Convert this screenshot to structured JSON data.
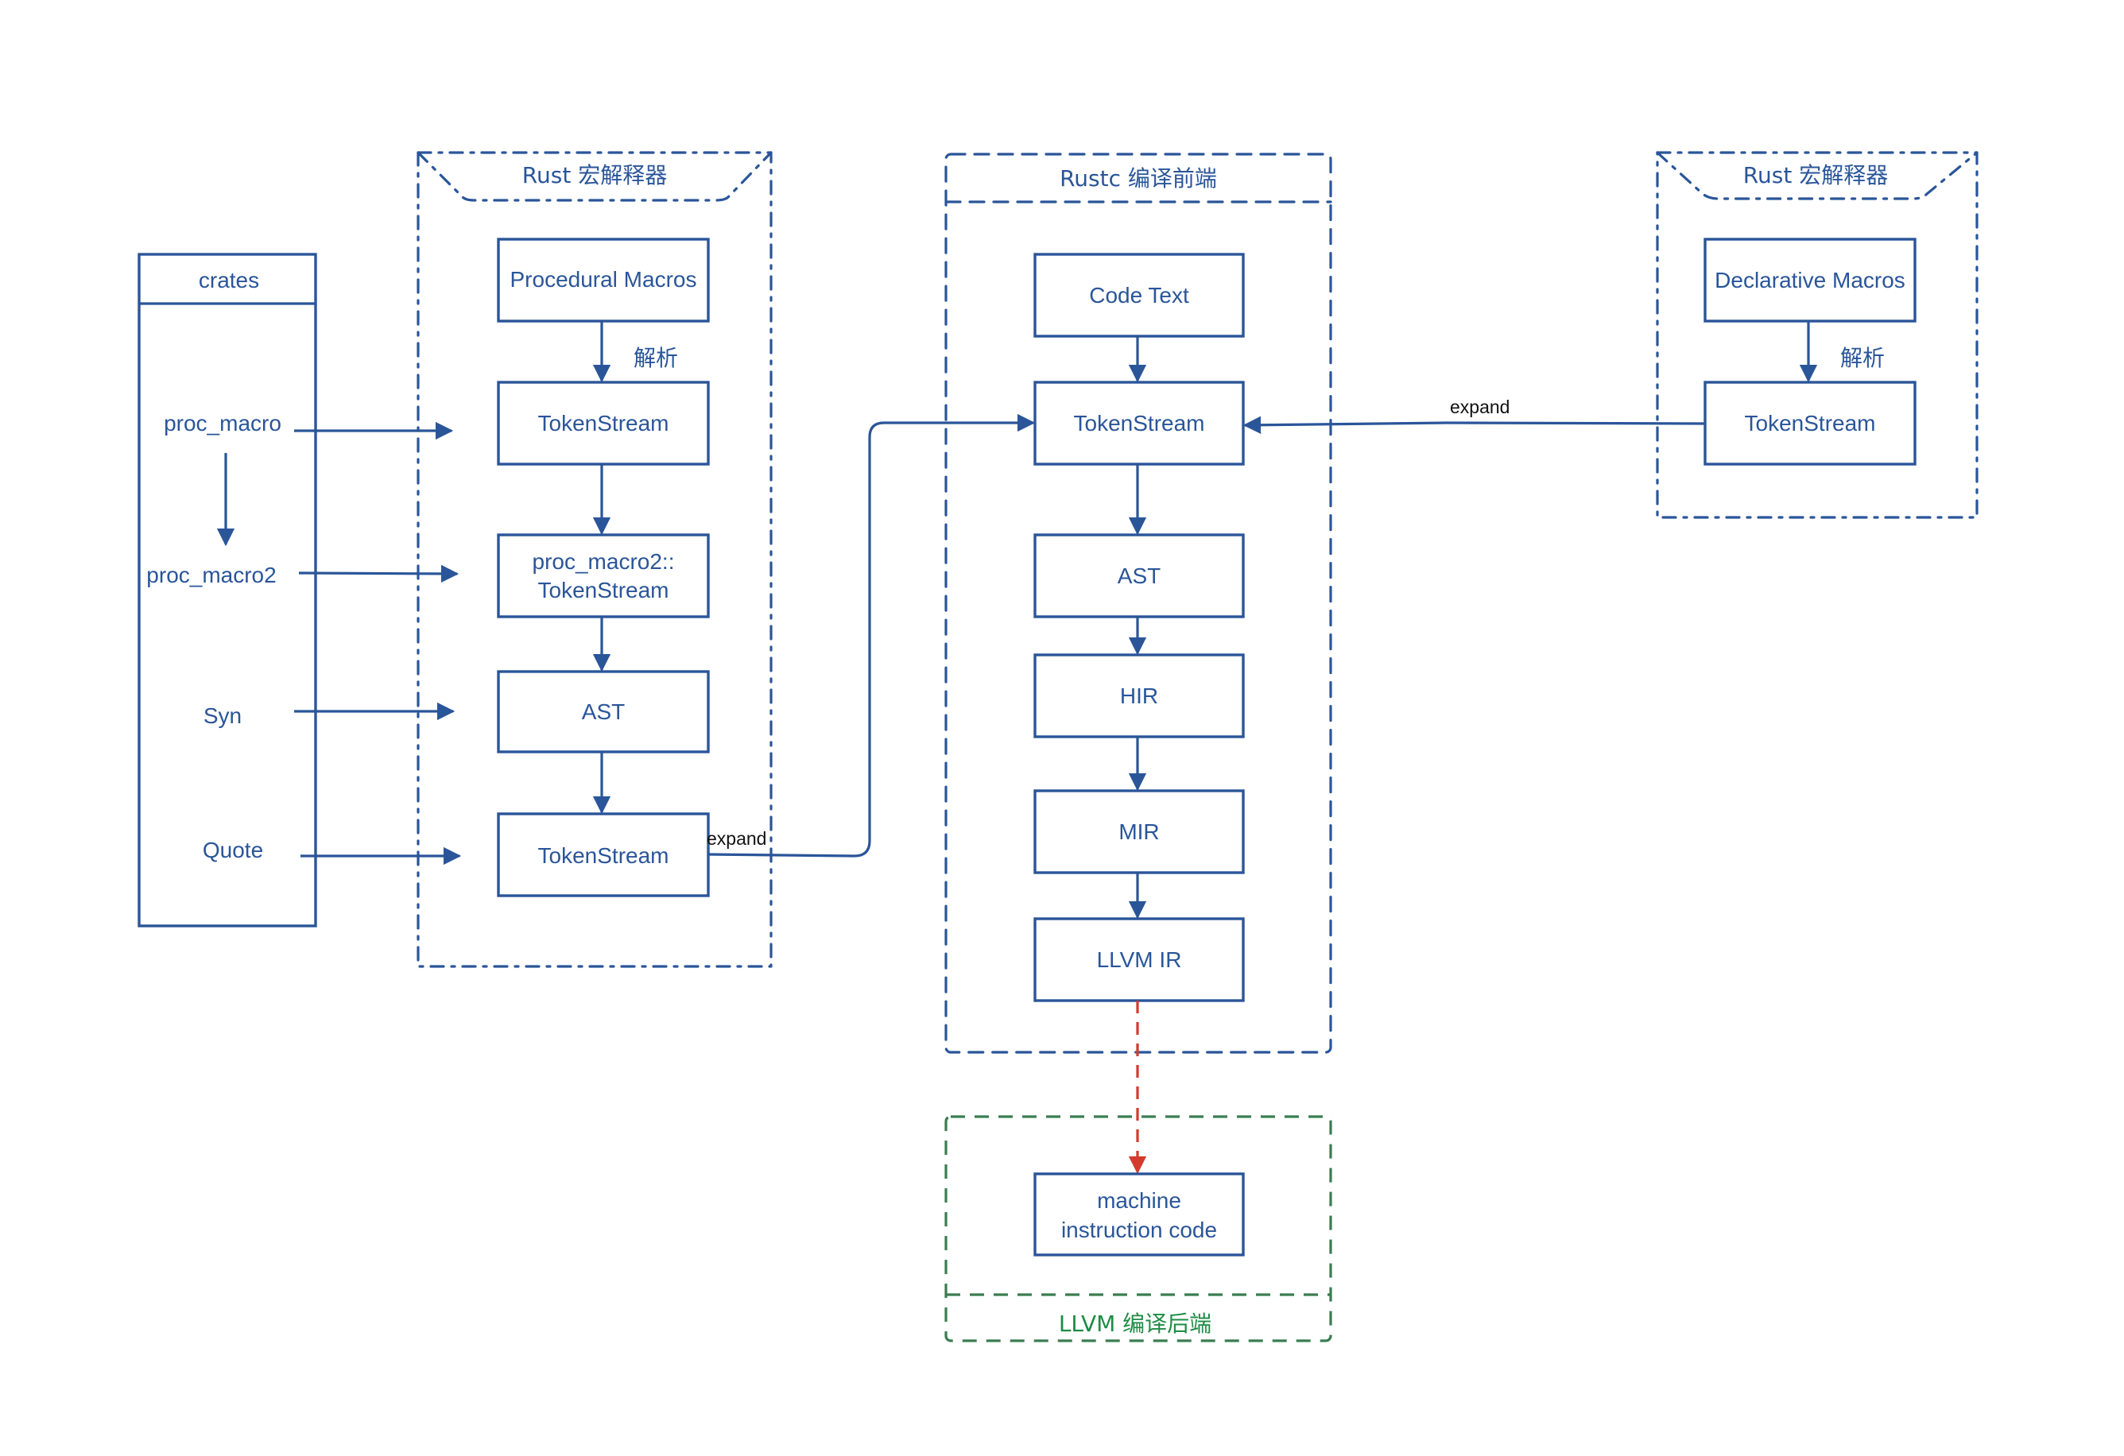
{
  "colors": {
    "primary": "#2a5599",
    "dashed_arrow": "#d33a2c",
    "backend_border": "#3a7d50",
    "backend_text": "#1e8c45",
    "edge_label": "#111111"
  },
  "crates": {
    "title": "crates",
    "items": [
      "proc_macro",
      "proc_macro2",
      "Syn",
      "Quote"
    ]
  },
  "proc_macro_group": {
    "title": "Rust  宏解释器",
    "nodes": [
      "Procedural Macros",
      "TokenStream",
      "proc_macro2::",
      "TokenStream",
      "AST",
      "TokenStream"
    ],
    "parse_label": "解析",
    "expand_label": "expand"
  },
  "frontend_group": {
    "title": "Rustc 编译前端",
    "nodes": [
      "Code Text",
      "TokenStream",
      "AST",
      "HIR",
      "MIR",
      "LLVM IR"
    ]
  },
  "backend_group": {
    "title": "LLVM 编译后端",
    "node_line1": "machine",
    "node_line2": "instruction code"
  },
  "declarative_group": {
    "title": "Rust  宏解释器",
    "nodes": [
      "Declarative Macros",
      "TokenStream"
    ],
    "parse_label": "解析",
    "expand_label": "expand"
  }
}
